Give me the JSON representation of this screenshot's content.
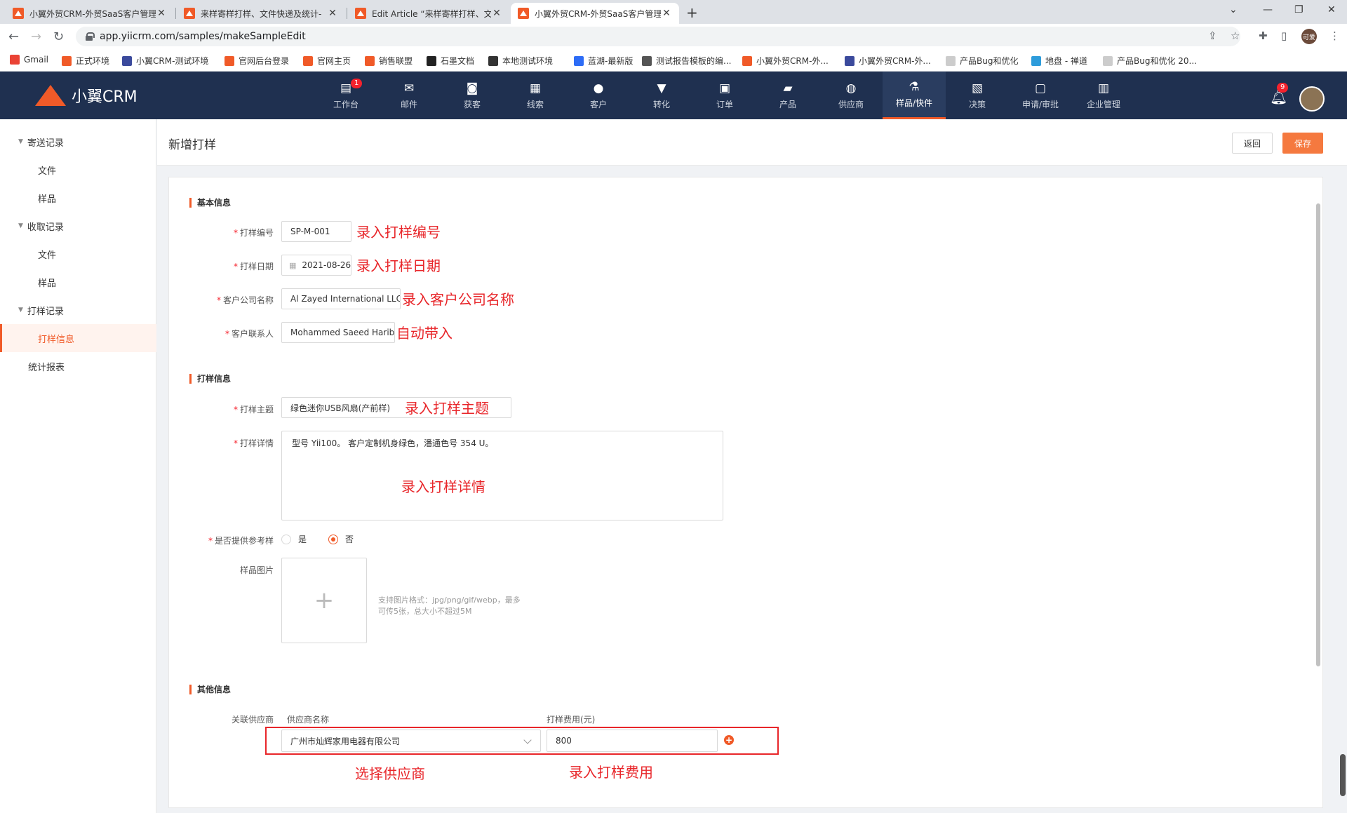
{
  "browser": {
    "tabs": [
      {
        "label": "小翼外贸CRM-外贸SaaS客户管理"
      },
      {
        "label": "来样寄样打样、文件快递及统计-"
      },
      {
        "label": "Edit Article “来样寄样打样、文件"
      },
      {
        "label": "小翼外贸CRM-外贸SaaS客户管理"
      }
    ],
    "url": "app.yiicrm.com/samples/makeSampleEdit",
    "profile_initials": "可爱",
    "bookmarks": [
      {
        "label": "Gmail",
        "color": "#ea4335"
      },
      {
        "label": "正式环境",
        "color": "#f05a28"
      },
      {
        "label": "小翼CRM-测试环境",
        "color": "#3b4a9c"
      },
      {
        "label": "官网后台登录",
        "color": "#f05a28"
      },
      {
        "label": "官网主页",
        "color": "#f05a28"
      },
      {
        "label": "销售联盟",
        "color": "#f05a28"
      },
      {
        "label": "石墨文档",
        "color": "#222222"
      },
      {
        "label": "本地测试环境",
        "color": "#333333"
      },
      {
        "label": "蓝湖-最新版",
        "color": "#2d6cf6"
      },
      {
        "label": "测试报告模板的编...",
        "color": "#555555"
      },
      {
        "label": "小翼外贸CRM-外...",
        "color": "#f05a28"
      },
      {
        "label": "小翼外贸CRM-外...",
        "color": "#3b4a9c"
      },
      {
        "label": "产品Bug和优化",
        "color": "#cccccc"
      },
      {
        "label": "地盘 - 禅道",
        "color": "#2d9cdb"
      },
      {
        "label": "产品Bug和优化 20...",
        "color": "#cccccc"
      }
    ]
  },
  "app": {
    "logo_text": "小翼CRM",
    "brand_color": "#f05a28",
    "nav": [
      {
        "label": "工作台",
        "icon": "workbench-icon",
        "glyph": "▤",
        "badge": "1"
      },
      {
        "label": "邮件",
        "icon": "mail-icon",
        "glyph": "✉"
      },
      {
        "label": "获客",
        "icon": "acquire-icon",
        "glyph": "◙"
      },
      {
        "label": "线索",
        "icon": "lead-icon",
        "glyph": "▦"
      },
      {
        "label": "客户",
        "icon": "customer-icon",
        "glyph": "●"
      },
      {
        "label": "转化",
        "icon": "funnel-icon",
        "glyph": "▼"
      },
      {
        "label": "订单",
        "icon": "order-icon",
        "glyph": "▣"
      },
      {
        "label": "产品",
        "icon": "product-icon",
        "glyph": "▰"
      },
      {
        "label": "供应商",
        "icon": "supplier-icon",
        "glyph": "◍"
      },
      {
        "label": "样品/快件",
        "icon": "flask-icon",
        "glyph": "⚗"
      },
      {
        "label": "决策",
        "icon": "chart-icon",
        "glyph": "▧"
      },
      {
        "label": "申请/审批",
        "icon": "approval-icon",
        "glyph": "▢"
      },
      {
        "label": "企业管理",
        "icon": "building-icon",
        "glyph": "▥"
      }
    ],
    "notification_count": "9"
  },
  "sidebar": {
    "items": [
      {
        "label": "寄送记录",
        "level": 1,
        "expanded": true
      },
      {
        "label": "文件",
        "level": 2
      },
      {
        "label": "样品",
        "level": 2
      },
      {
        "label": "收取记录",
        "level": 1,
        "expanded": true
      },
      {
        "label": "文件",
        "level": 2
      },
      {
        "label": "样品",
        "level": 2
      },
      {
        "label": "打样记录",
        "level": 1,
        "expanded": true
      },
      {
        "label": "打样信息",
        "level": 2,
        "active": true
      },
      {
        "label": "统计报表",
        "level": 1
      }
    ]
  },
  "page": {
    "title": "新增打样",
    "back_label": "返回",
    "save_label": "保存"
  },
  "form": {
    "section_basic": "基本信息",
    "section_sample": "打样信息",
    "section_other": "其他信息",
    "sample_no": {
      "label": "打样编号",
      "value": "SP-M-001",
      "annotation": "录入打样编号"
    },
    "sample_date": {
      "label": "打样日期",
      "value": "2021-08-26",
      "annotation": "录入打样日期"
    },
    "company": {
      "label": "客户公司名称",
      "value": "Al Zayed International LLC",
      "annotation": "录入客户公司名称"
    },
    "contact": {
      "label": "客户联系人",
      "value": "Mohammed Saeed Harib",
      "annotation": "自动带入"
    },
    "subject": {
      "label": "打样主题",
      "value": "绿色迷你USB风扇(产前样)",
      "annotation": "录入打样主题"
    },
    "detail": {
      "label": "打样详情",
      "value": "型号 Yii100。 客户定制机身绿色，潘通色号 354 U。",
      "annotation": "录入打样详情"
    },
    "reference": {
      "label": "是否提供参考样",
      "yes": "是",
      "no": "否",
      "selected": "否"
    },
    "image": {
      "label": "样品图片",
      "hint_line1": "支持图片格式：jpg/png/gif/webp，最多",
      "hint_line2": "可传5张，总大小不超过5M"
    },
    "supplier": {
      "label": "关联供应商",
      "col_name": "供应商名称",
      "col_fee": "打样费用(元)",
      "name_value": "广州市灿辉家用电器有限公司",
      "fee_value": "800",
      "annotation_name": "选择供应商",
      "annotation_fee": "录入打样费用"
    }
  }
}
